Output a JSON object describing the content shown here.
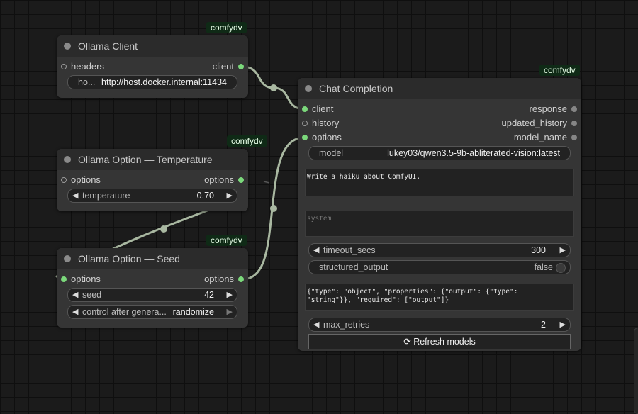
{
  "colors": {
    "link": "#a9b8a1",
    "badge_bg": "#0f2a16",
    "slot_connected": "#7bd87b",
    "canvas": "#1b1b1b"
  },
  "nodes": {
    "client": {
      "badge": "comfydv",
      "title": "Ollama Client",
      "in_headers": "headers",
      "out_client": "client",
      "host_label": "ho...",
      "host_value": "http://host.docker.internal:11434"
    },
    "temperature": {
      "badge": "comfydv",
      "title": "Ollama Option — Temperature",
      "in_options": "options",
      "out_options": "options",
      "w_label": "temperature",
      "w_value": "0.70"
    },
    "seed": {
      "badge": "comfydv",
      "title": "Ollama Option — Seed",
      "in_options": "options",
      "out_options": "options",
      "seed_label": "seed",
      "seed_value": "42",
      "control_label": "control after genera...",
      "control_value": "randomize"
    },
    "chat": {
      "badge": "comfydv",
      "title": "Chat Completion",
      "in_client": "client",
      "in_history": "history",
      "in_options": "options",
      "out_response": "response",
      "out_updated_history": "updated_history",
      "out_model_name": "model_name",
      "model_label": "model",
      "model_value": "lukey03/qwen3.5-9b-abliterated-vision:latest",
      "prompt": "Write a haiku about ComfyUI.",
      "system_placeholder": "system",
      "timeout_label": "timeout_secs",
      "timeout_value": "300",
      "structured_label": "structured_output",
      "structured_value": "false",
      "schema": "{\"type\": \"object\", \"properties\": {\"output\": {\"type\":\n\"string\"}}, \"required\": [\"output\"]}",
      "retries_label": "max_retries",
      "retries_value": "2",
      "refresh_label": "⟳ Refresh models"
    }
  }
}
